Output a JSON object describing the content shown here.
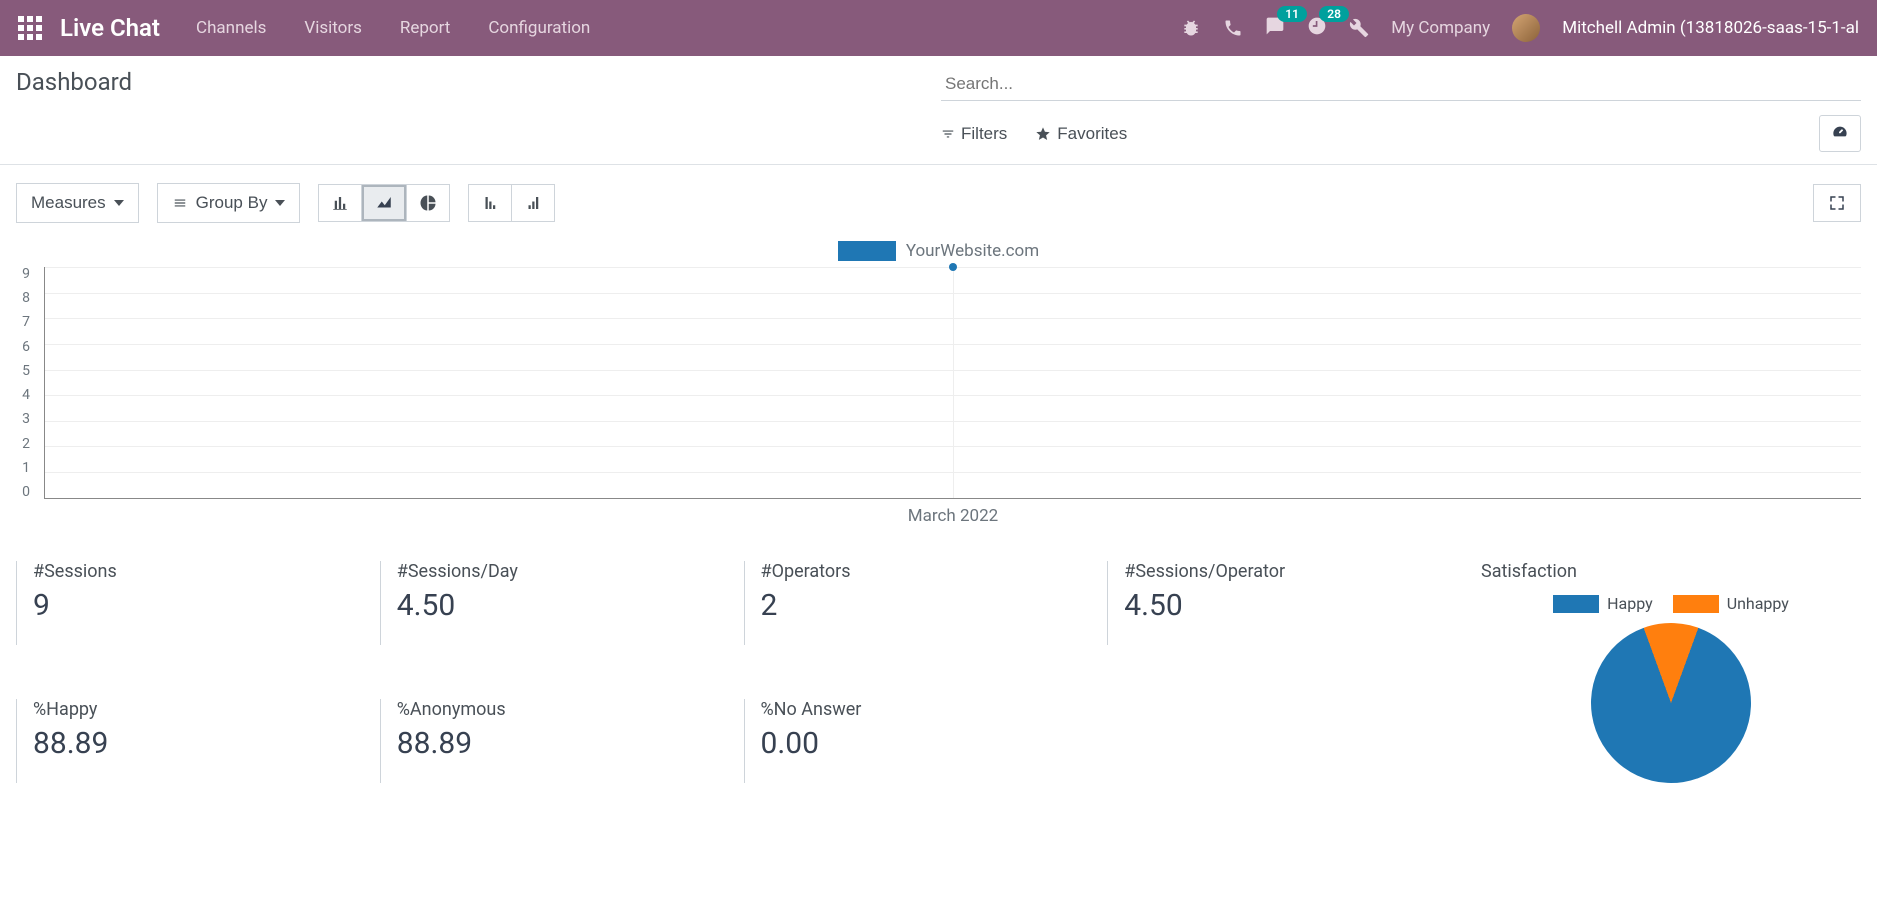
{
  "navbar": {
    "brand": "Live Chat",
    "links": [
      "Channels",
      "Visitors",
      "Report",
      "Configuration"
    ],
    "msg_badge": "11",
    "activity_badge": "28",
    "company": "My Company",
    "user": "Mitchell Admin (13818026-saas-15-1-al"
  },
  "header": {
    "title": "Dashboard",
    "search_placeholder": "Search...",
    "filters_label": "Filters",
    "favorites_label": "Favorites"
  },
  "toolbar": {
    "measures_label": "Measures",
    "groupby_label": "Group By"
  },
  "chart_data": {
    "type": "line",
    "legend": "YourWebsite.com",
    "categories": [
      "March 2022"
    ],
    "values": [
      9
    ],
    "ylim": [
      0,
      9
    ],
    "yticks": [
      "9",
      "8",
      "7",
      "6",
      "5",
      "4",
      "3",
      "2",
      "1",
      "0"
    ]
  },
  "stats": [
    {
      "label": "#Sessions",
      "value": "9"
    },
    {
      "label": "#Sessions/Day",
      "value": "4.50"
    },
    {
      "label": "#Operators",
      "value": "2"
    },
    {
      "label": "#Sessions/Operator",
      "value": "4.50"
    },
    {
      "label": "%Happy",
      "value": "88.89"
    },
    {
      "label": "%Anonymous",
      "value": "88.89"
    },
    {
      "label": "%No Answer",
      "value": "0.00"
    }
  ],
  "satisfaction": {
    "title": "Satisfaction",
    "legend": [
      {
        "label": "Happy",
        "color": "#1f77b4"
      },
      {
        "label": "Unhappy",
        "color": "#ff7f0e"
      }
    ],
    "chart_data": {
      "type": "pie",
      "series": [
        {
          "name": "Happy",
          "value": 88.89
        },
        {
          "name": "Unhappy",
          "value": 11.11
        }
      ]
    }
  }
}
